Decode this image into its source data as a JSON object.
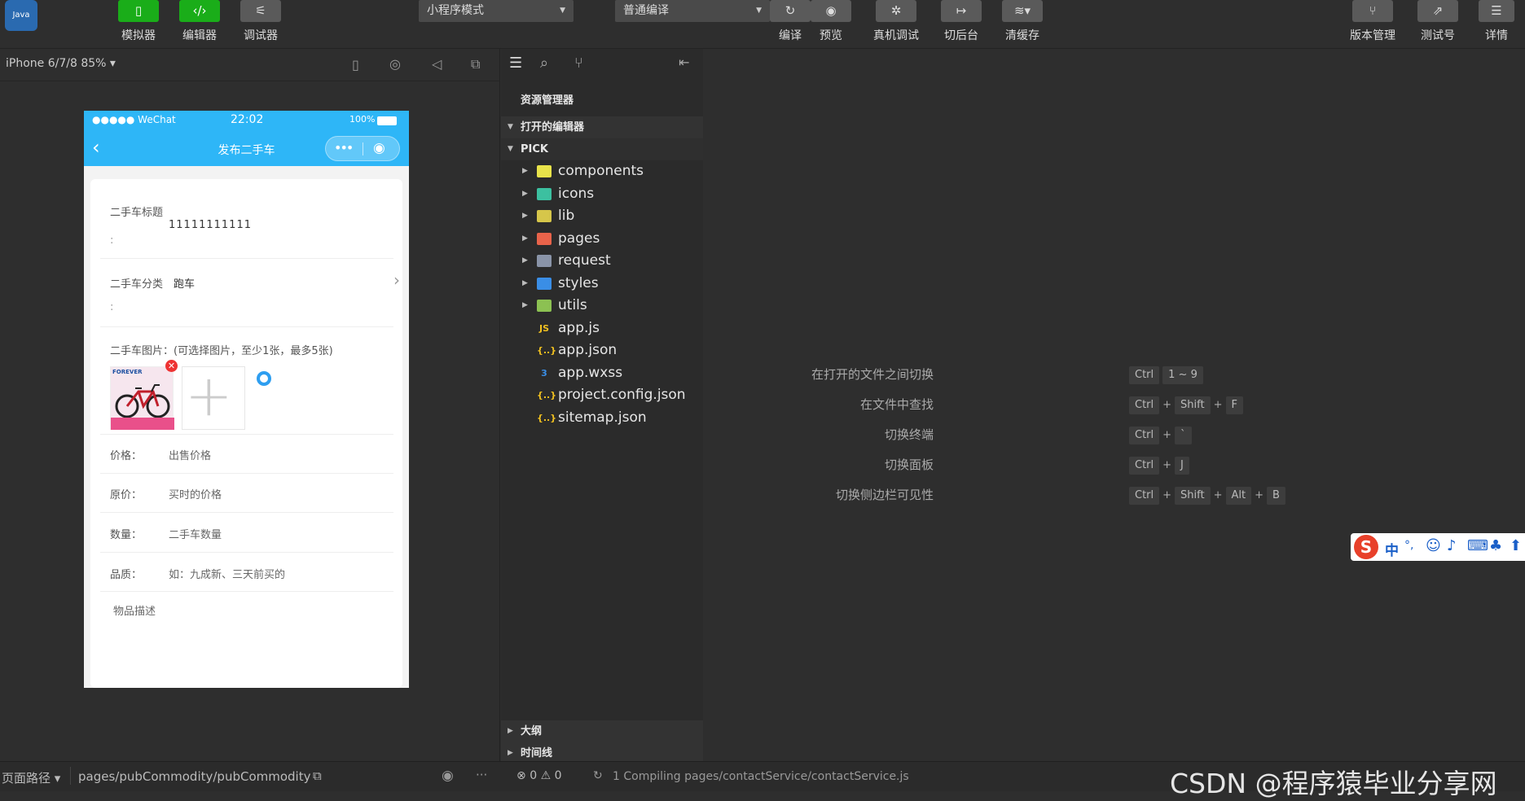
{
  "toolbar": {
    "left_buttons": [
      {
        "label": "模拟器",
        "icon": "phone-icon"
      },
      {
        "label": "编辑器",
        "icon": "code-icon"
      },
      {
        "label": "调试器",
        "icon": "debug-icon"
      }
    ],
    "mode_select": "小程序模式",
    "compile_select": "普通编译",
    "mid_buttons": [
      {
        "label": "编译",
        "icon": "refresh-icon"
      },
      {
        "label": "预览",
        "icon": "eye-icon"
      },
      {
        "label": "真机调试",
        "icon": "bug-icon"
      },
      {
        "label": "切后台",
        "icon": "switch-icon"
      },
      {
        "label": "清缓存",
        "icon": "layers-icon"
      }
    ],
    "right_buttons": [
      {
        "label": "版本管理",
        "icon": "branch-icon"
      },
      {
        "label": "测试号",
        "icon": "external-icon"
      },
      {
        "label": "详情",
        "icon": "menu-icon"
      }
    ]
  },
  "simulator": {
    "device": "iPhone 6/7/8 85%",
    "status_carrier": "●●●●● WeChat",
    "status_time": "22:02",
    "status_battery": "100%",
    "page_title": "发布二手车",
    "form": {
      "title_label": "二手车标题",
      "title_value": "11111111111",
      "title_colon": ":",
      "category_label": "二手车分类",
      "category_value": "跑车",
      "category_colon": ":",
      "images_label": "二手车图片：(可选择图片，至少1张，最多5张)",
      "image_brand": "FOREVER",
      "price_label": "价格：",
      "price_placeholder": "出售价格",
      "orig_label": "原价：",
      "orig_placeholder": "买时的价格",
      "qty_label": "数量：",
      "qty_placeholder": "二手车数量",
      "quality_label": "品质：",
      "quality_placeholder": "如：九成新、三天前买的",
      "desc_label": "物品描述"
    }
  },
  "explorer": {
    "title": "资源管理器",
    "open_editors": "打开的编辑器",
    "project": "PICK",
    "items": [
      {
        "name": "components",
        "type": "folder",
        "color": "#e8e34a"
      },
      {
        "name": "icons",
        "type": "folder",
        "color": "#3cc0a0"
      },
      {
        "name": "lib",
        "type": "folder",
        "color": "#d6c64a"
      },
      {
        "name": "pages",
        "type": "folder",
        "color": "#e8634a"
      },
      {
        "name": "request",
        "type": "folder",
        "color": "#8a94a8"
      },
      {
        "name": "styles",
        "type": "folder",
        "color": "#3a8ee6"
      },
      {
        "name": "utils",
        "type": "folder",
        "color": "#8cc152"
      },
      {
        "name": "app.js",
        "type": "file",
        "color": "#f0c020",
        "glyph": "JS"
      },
      {
        "name": "app.json",
        "type": "file",
        "color": "#f0c020",
        "glyph": "{..}"
      },
      {
        "name": "app.wxss",
        "type": "file",
        "color": "#3a8ee6",
        "glyph": "3"
      },
      {
        "name": "project.config.json",
        "type": "file",
        "color": "#f0c020",
        "glyph": "{..}"
      },
      {
        "name": "sitemap.json",
        "type": "file",
        "color": "#f0c020",
        "glyph": "{..}"
      }
    ],
    "outline": "大纲",
    "timeline": "时间线"
  },
  "shortcuts": [
    {
      "label": "在打开的文件之间切换",
      "keys": [
        "Ctrl",
        "1 ~ 9"
      ]
    },
    {
      "label": "在文件中查找",
      "keys": [
        "Ctrl",
        "+",
        "Shift",
        "+",
        "F"
      ]
    },
    {
      "label": "切换终端",
      "keys": [
        "Ctrl",
        "+",
        "`"
      ]
    },
    {
      "label": "切换面板",
      "keys": [
        "Ctrl",
        "+",
        "J"
      ]
    },
    {
      "label": "切换侧边栏可见性",
      "keys": [
        "Ctrl",
        "+",
        "Shift",
        "+",
        "Alt",
        "+",
        "B"
      ]
    }
  ],
  "ime": {
    "lang": "中",
    "punct": "°,"
  },
  "footer": {
    "path_label": "页面路径",
    "path": "pages/pubCommodity/pubCommodity",
    "errors": "0",
    "warnings": "0",
    "compile_status": "1 Compiling pages/contactService/contactService.js"
  },
  "watermark": "CSDN @程序猿毕业分享网",
  "colors": {
    "accent_green": "#1aad19",
    "wechat_nav": "#2eb6f7",
    "bg": "#2e2e2e"
  }
}
